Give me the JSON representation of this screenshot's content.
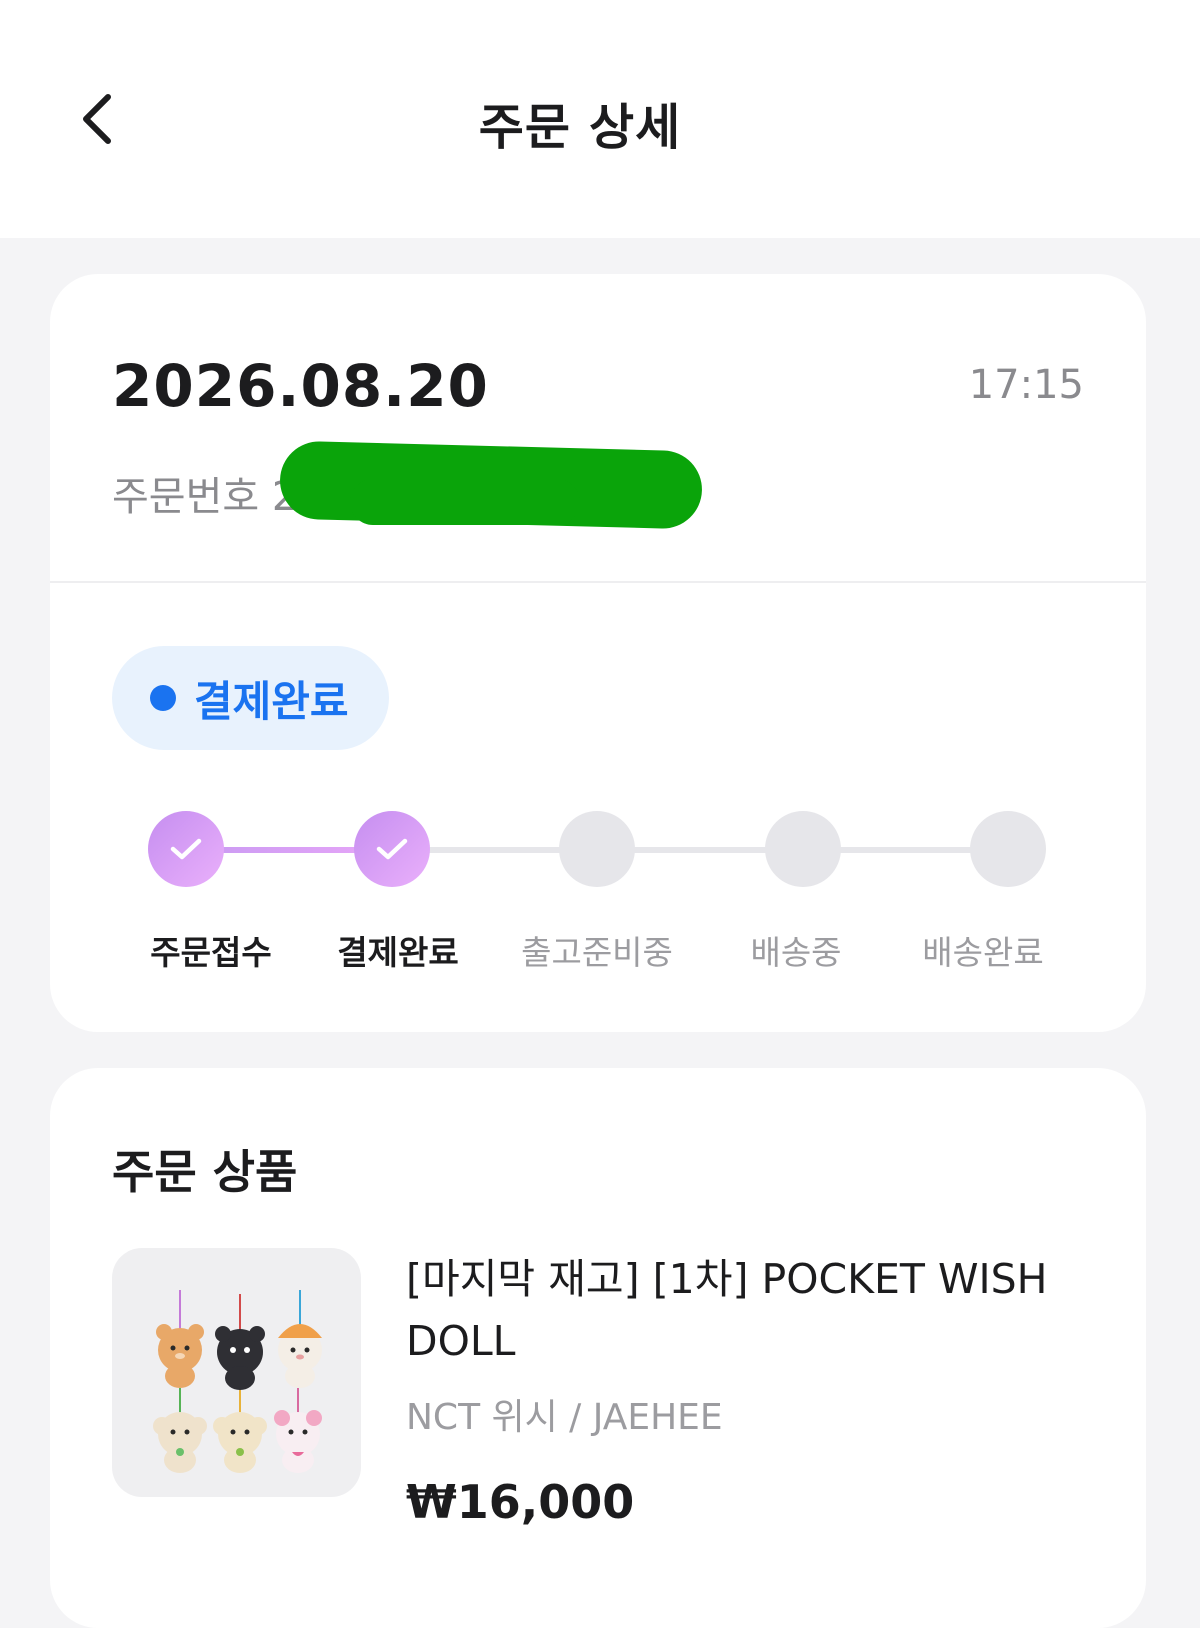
{
  "header": {
    "title": "주문 상세",
    "back_icon": "chevron-left-icon"
  },
  "order": {
    "date": "2026.08.20",
    "time": "17:15",
    "number_label": "주문번호 20",
    "status": "결제완료",
    "status_color": "#1a73f0",
    "progress_accent": "#c58ef0",
    "steps": [
      {
        "label": "주문접수",
        "completed": true
      },
      {
        "label": "결제완료",
        "completed": true
      },
      {
        "label": "출고준비중",
        "completed": false
      },
      {
        "label": "배송중",
        "completed": false
      },
      {
        "label": "배송완료",
        "completed": false
      }
    ]
  },
  "products": {
    "title": "주문 상품",
    "items": [
      {
        "name": "[마지막 재고] [1차] POCKET WISH DOLL",
        "option": "NCT 위시 / JAEHEE",
        "price": "₩16,000",
        "thumbnail_icon": "plush-doll-keyrings-image"
      }
    ]
  }
}
